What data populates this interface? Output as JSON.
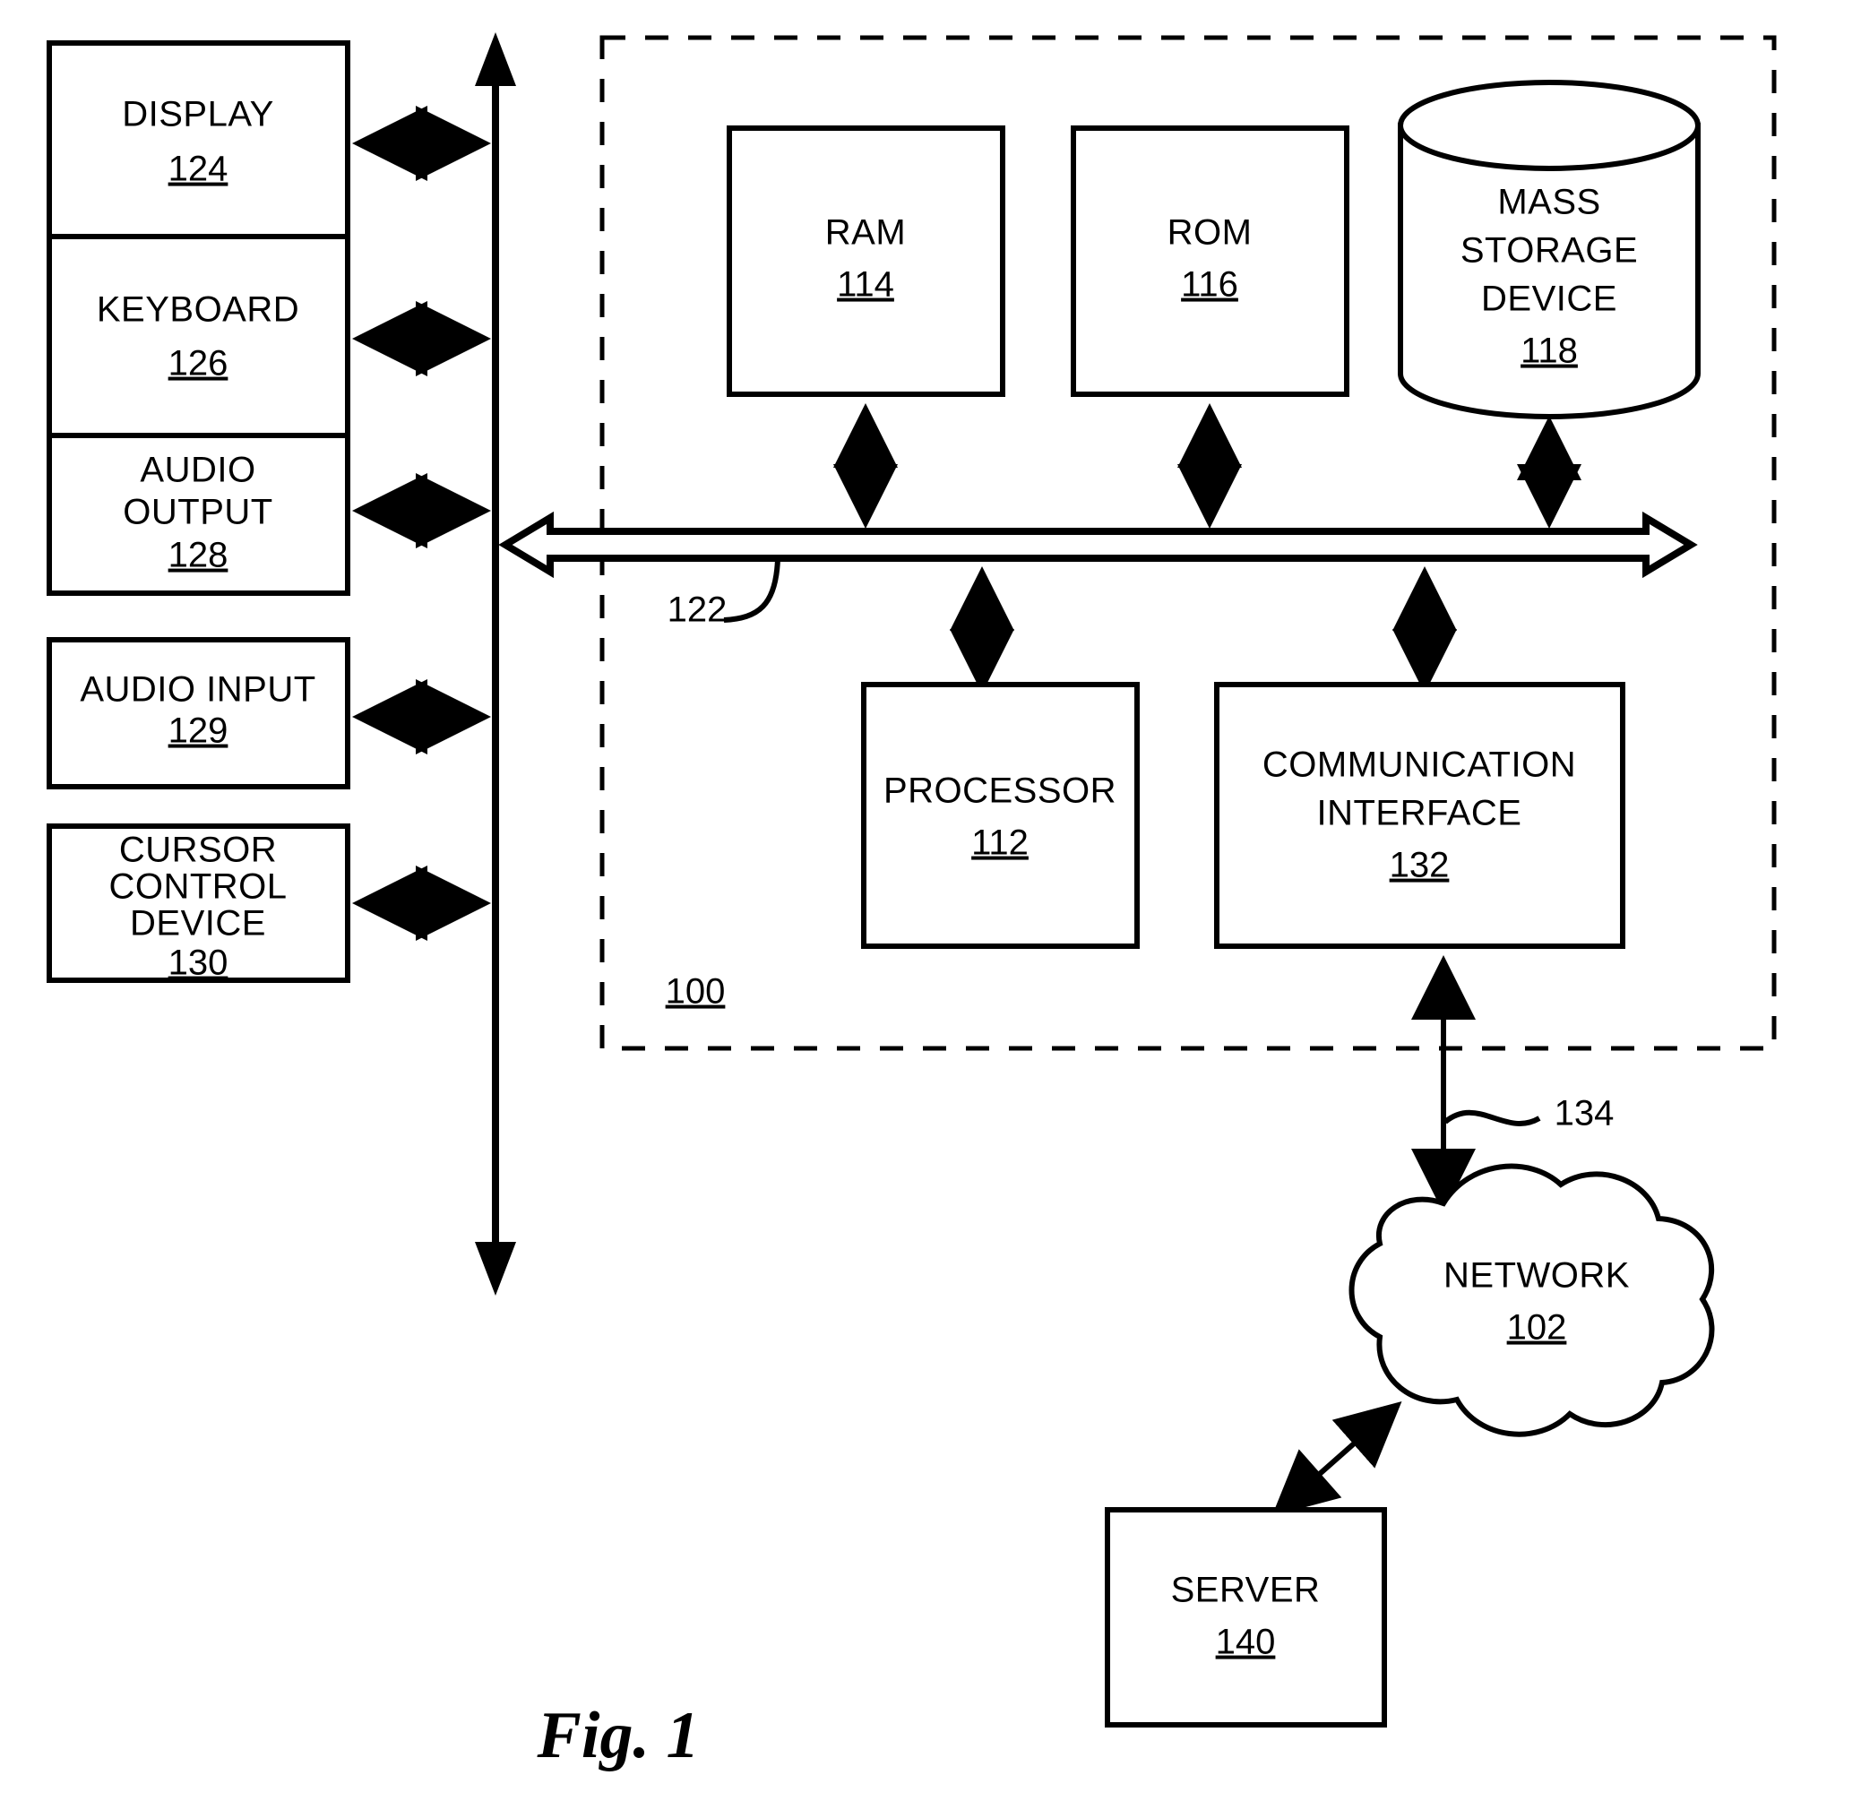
{
  "figure": {
    "caption": "Fig. 1",
    "system_ref": "100",
    "bus_ref": "122",
    "network_link_ref": "134"
  },
  "peripherals": [
    {
      "name": "DISPLAY",
      "ref": "124",
      "lines": [
        "DISPLAY"
      ]
    },
    {
      "name": "KEYBOARD",
      "ref": "126",
      "lines": [
        "KEYBOARD"
      ]
    },
    {
      "name": "AUDIO OUTPUT",
      "ref": "128",
      "lines": [
        "AUDIO",
        "OUTPUT"
      ]
    },
    {
      "name": "AUDIO INPUT",
      "ref": "129",
      "lines": [
        "AUDIO INPUT"
      ]
    },
    {
      "name": "CURSOR CONTROL DEVICE",
      "ref": "130",
      "lines": [
        "CURSOR",
        "CONTROL",
        "DEVICE"
      ]
    }
  ],
  "memory": [
    {
      "name": "RAM",
      "ref": "114",
      "lines": [
        "RAM"
      ]
    },
    {
      "name": "ROM",
      "ref": "116",
      "lines": [
        "ROM"
      ]
    }
  ],
  "storage": {
    "name": "MASS STORAGE DEVICE",
    "ref": "118",
    "lines": [
      "MASS",
      "STORAGE",
      "DEVICE"
    ]
  },
  "compute": [
    {
      "name": "PROCESSOR",
      "ref": "112",
      "lines": [
        "PROCESSOR"
      ]
    },
    {
      "name": "COMMUNICATION INTERFACE",
      "ref": "132",
      "lines": [
        "COMMUNICATION",
        "INTERFACE"
      ]
    }
  ],
  "network": {
    "name": "NETWORK",
    "ref": "102",
    "lines": [
      "NETWORK"
    ]
  },
  "server": {
    "name": "SERVER",
    "ref": "140",
    "lines": [
      "SERVER"
    ]
  },
  "colors": {
    "ink": "#000000",
    "paper": "#ffffff"
  }
}
